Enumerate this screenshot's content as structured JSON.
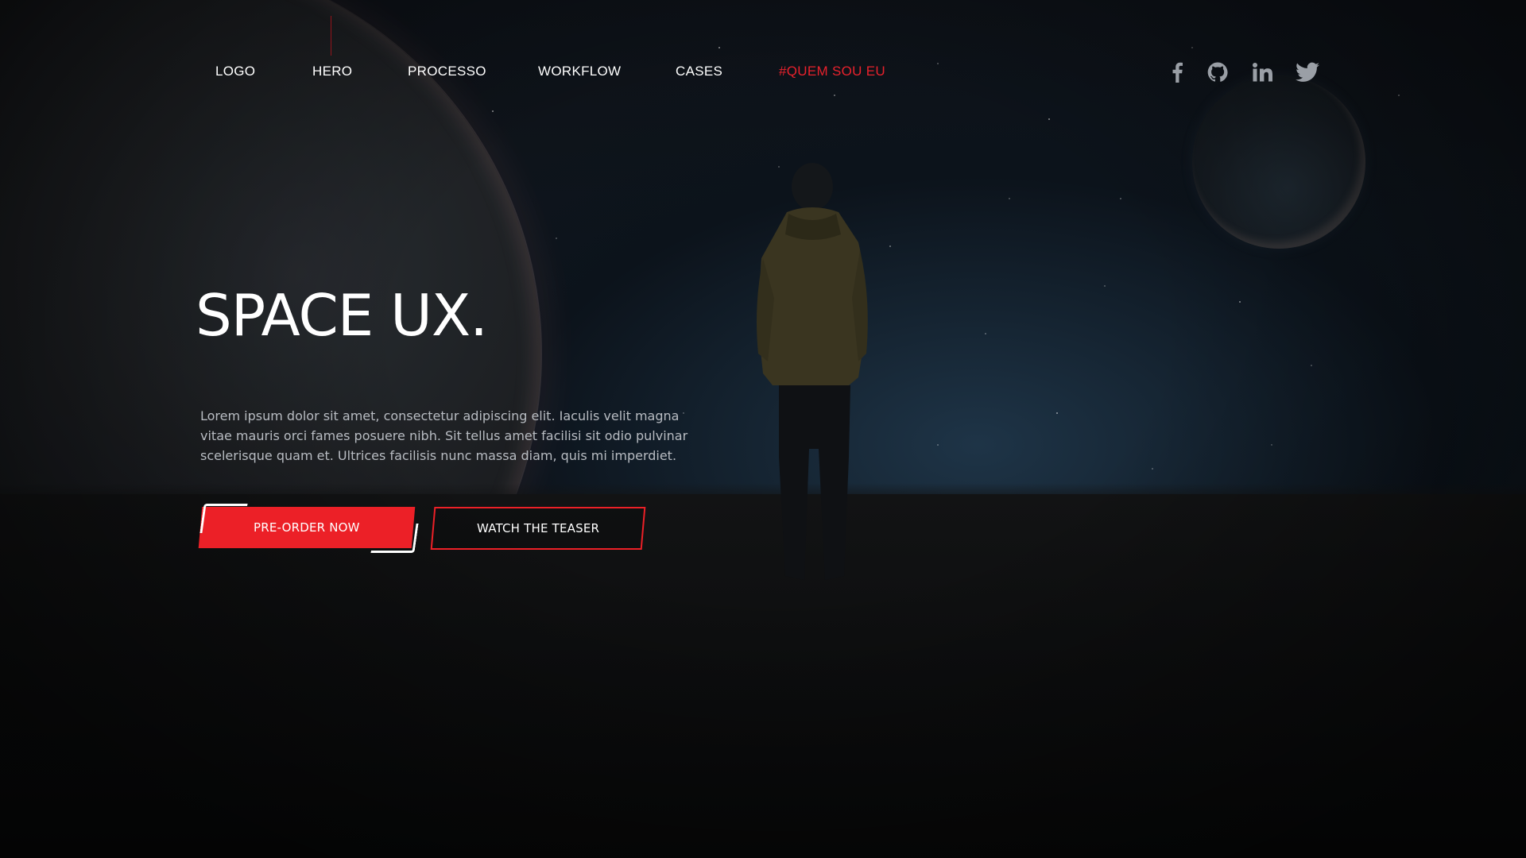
{
  "nav": {
    "items": [
      {
        "label": "LOGO"
      },
      {
        "label": "HERO"
      },
      {
        "label": "PROCESSO"
      },
      {
        "label": "WORKFLOW"
      },
      {
        "label": "CASES"
      },
      {
        "label": "#QUEM SOU EU"
      }
    ],
    "active_index": 5
  },
  "social": {
    "icons": [
      "facebook-icon",
      "github-icon",
      "linkedin-icon",
      "twitter-icon"
    ]
  },
  "hero": {
    "title": "SPACE UX.",
    "description": "Lorem ipsum dolor sit amet, consectetur adipiscing elit. Iaculis velit magna vitae mauris orci fames posuere nibh. Sit tellus amet facilisi sit odio pulvinar scelerisque quam et. Ultrices facilisis nunc massa diam, quis mi imperdiet.",
    "primary_button": "PRE-ORDER NOW",
    "secondary_button": "WATCH THE TEASER"
  },
  "colors": {
    "accent": "#ec2027",
    "background": "#0a0c10",
    "text": "#ffffff",
    "muted_text": "#b8bcc2",
    "icon": "#9a9fa6"
  }
}
